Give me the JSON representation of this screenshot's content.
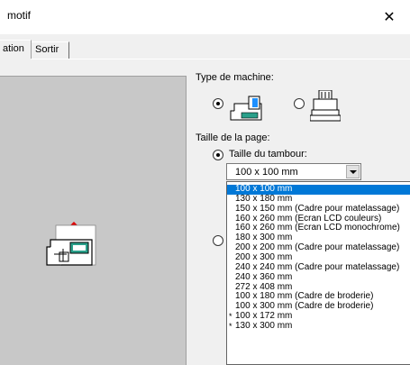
{
  "window": {
    "title": "motif",
    "close_glyph": "✕"
  },
  "tabs": [
    {
      "label": "ation",
      "active": true
    },
    {
      "label": "Sortir",
      "active": false
    }
  ],
  "machine_type": {
    "label": "Type de machine:",
    "options": [
      {
        "icon": "sewing-embroidery-machine-icon",
        "checked": true
      },
      {
        "icon": "multi-needle-machine-icon",
        "checked": false
      }
    ]
  },
  "page_size": {
    "label": "Taille de la page:",
    "hoop_option": {
      "label": "Taille du tambour:",
      "checked": true
    },
    "second_option": {
      "checked": false
    }
  },
  "hoop_combo": {
    "value": "100 x 100 mm"
  },
  "hoop_list": [
    {
      "label": "100 x 100 mm",
      "selected": true,
      "mark": ""
    },
    {
      "label": "130 x 180 mm",
      "selected": false,
      "mark": ""
    },
    {
      "label": "150 x 150 mm (Cadre pour matelassage)",
      "selected": false,
      "mark": ""
    },
    {
      "label": "160 x 260 mm (Ecran LCD couleurs)",
      "selected": false,
      "mark": ""
    },
    {
      "label": "160 x 260 mm (Ecran LCD monochrome)",
      "selected": false,
      "mark": ""
    },
    {
      "label": "180 x 300 mm",
      "selected": false,
      "mark": ""
    },
    {
      "label": "200 x 200 mm (Cadre pour matelassage)",
      "selected": false,
      "mark": ""
    },
    {
      "label": "200 x 300 mm",
      "selected": false,
      "mark": ""
    },
    {
      "label": "240 x 240 mm (Cadre pour matelassage)",
      "selected": false,
      "mark": ""
    },
    {
      "label": "240 x 360 mm",
      "selected": false,
      "mark": ""
    },
    {
      "label": "272 x 408 mm",
      "selected": false,
      "mark": ""
    },
    {
      "label": "100 x 180 mm (Cadre de broderie)",
      "selected": false,
      "mark": ""
    },
    {
      "label": "100 x 300 mm (Cadre de broderie)",
      "selected": false,
      "mark": ""
    },
    {
      "label": "100 x 172 mm",
      "selected": false,
      "mark": "*"
    },
    {
      "label": "130 x 300 mm",
      "selected": false,
      "mark": "*"
    }
  ],
  "colors": {
    "selection": "#0078d7",
    "preview_bg": "#c8c8c8",
    "accent_blue": "#1e90ff",
    "teal": "#2aa08a",
    "red_marker": "#e00000"
  }
}
